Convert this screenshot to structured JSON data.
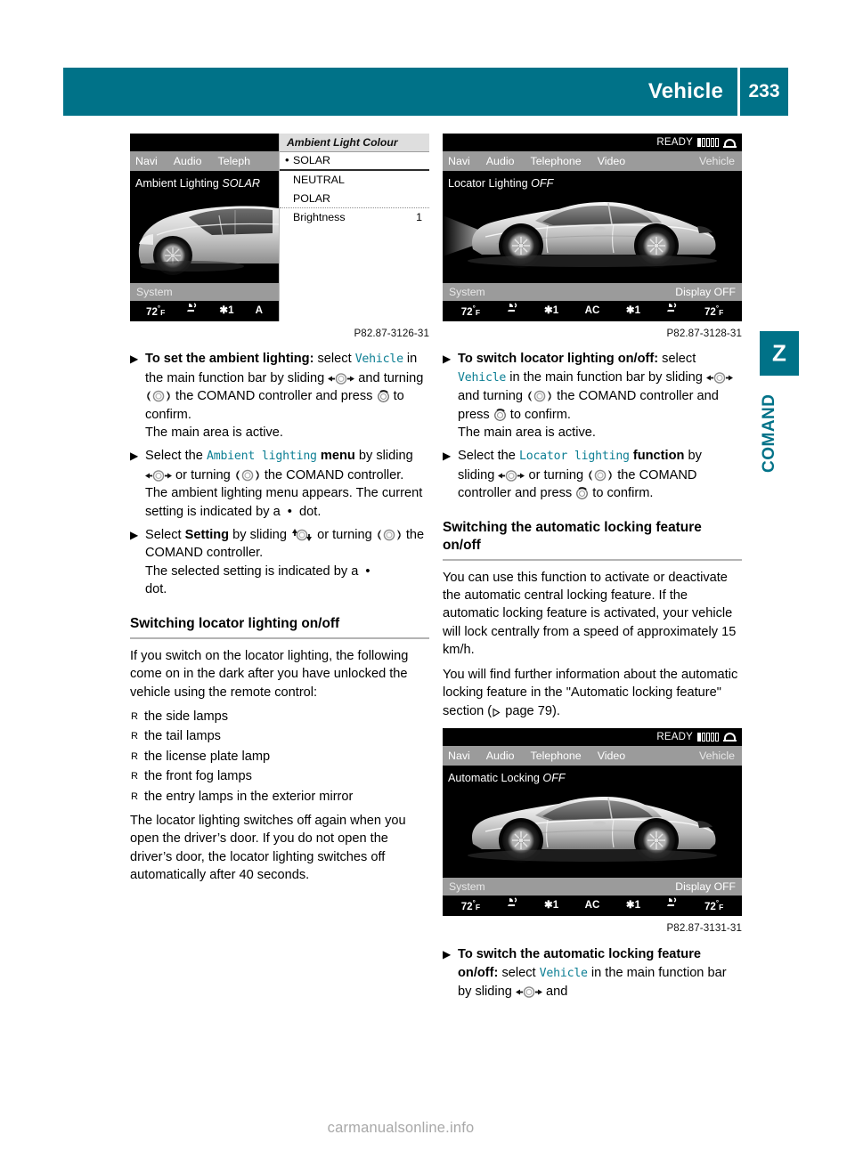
{
  "header": {
    "title": "Vehicle",
    "page_number": "233"
  },
  "side_tab": {
    "marker_letter": "Z",
    "label": "COMAND"
  },
  "figures": {
    "ambient": {
      "caption": "P82.87-3126-31",
      "menubar": [
        "Navi",
        "Audio",
        "Teleph"
      ],
      "main_title": "Ambient Lighting",
      "main_title_value": "SOLAR",
      "sysbar_left": "System",
      "climate": [
        "72",
        "F",
        "°1",
        "A"
      ],
      "climate_left_temp": "72",
      "climate_unit": "F",
      "climate_fan": "1",
      "list_title": "Ambient Light Colour",
      "list_items": [
        {
          "bullet": "•",
          "label": "SOLAR",
          "value": ""
        },
        {
          "bullet": "",
          "label": "NEUTRAL",
          "value": ""
        },
        {
          "bullet": "",
          "label": "POLAR",
          "value": ""
        },
        {
          "bullet": "",
          "label": "Brightness",
          "value": "1"
        }
      ]
    },
    "locator": {
      "caption": "P82.87-3128-31",
      "status_text": "READY",
      "menubar": [
        "Navi",
        "Audio",
        "Telephone",
        "Video"
      ],
      "menubar_selected": "Vehicle",
      "main_title": "Locator Lighting",
      "main_title_value": "OFF",
      "sysbar_left": "System",
      "sysbar_right": "Display OFF",
      "climate_left_temp": "72",
      "climate_right_temp": "72",
      "climate_unit": "F",
      "climate_fan_left": "1",
      "climate_fan_right": "1",
      "climate_ac": "AC"
    },
    "autolock": {
      "caption": "P82.87-3131-31",
      "status_text": "READY",
      "menubar": [
        "Navi",
        "Audio",
        "Telephone",
        "Video"
      ],
      "menubar_selected": "Vehicle",
      "main_title": "Automatic Locking",
      "main_title_value": "OFF",
      "sysbar_left": "System",
      "sysbar_right": "Display OFF",
      "climate_left_temp": "72",
      "climate_right_temp": "72",
      "climate_unit": "F",
      "climate_fan_left": "1",
      "climate_fan_right": "1",
      "climate_ac": "AC"
    }
  },
  "left_column": {
    "step1": {
      "lead": "To set the ambient lighting:",
      "t1": " select ",
      "mono1": "Vehicle",
      "t2": " in the main function bar by sliding ",
      "t3": " and turning ",
      "t4": " the COMAND controller and press ",
      "t5": " to confirm.",
      "result": "The main area is active."
    },
    "step2": {
      "t1": "Select the ",
      "mono1": "Ambient lighting",
      "bold1": " menu",
      "t2": " by sliding ",
      "t3": " or turning ",
      "t4": " the COMAND controller.",
      "result": "The ambient lighting menu appears. The current setting is indicated by a",
      "result_tail": "dot."
    },
    "step3": {
      "t1": "Select ",
      "bold1": "Setting",
      "t2": " by sliding ",
      "t3": " or turning ",
      "t4": " the COMAND controller.",
      "result": "The selected setting is indicated by a",
      "result_tail": "dot."
    },
    "heading": "Switching locator lighting on/off",
    "intro": "If you switch on the locator lighting, the following come on in the dark after you have unlocked the vehicle using the remote control:",
    "lamp_list": [
      "the side lamps",
      "the tail lamps",
      "the license plate lamp",
      "the front fog lamps",
      "the entry lamps in the exterior mirror"
    ],
    "outro": "The locator lighting switches off again when you open the driver’s door. If you do not open the driver’s door, the locator lighting switches off automatically after 40 seconds."
  },
  "right_column": {
    "step1": {
      "lead": "To switch locator lighting on/off:",
      "t1": " select ",
      "mono1": "Vehicle",
      "t2": " in the main function bar by sliding ",
      "t3": " and turning ",
      "t4": " the COMAND controller and press ",
      "t5": " to confirm.",
      "result": "The main area is active."
    },
    "step2": {
      "t1": "Select the ",
      "mono1": "Locator lighting",
      "bold1": " function",
      "t2": " by sliding ",
      "t3": " or turning ",
      "t4": " the COMAND controller and press ",
      "t5": " to confirm."
    },
    "heading": "Switching the automatic locking feature on/off",
    "para1": "You can use this function to activate or deactivate the automatic central locking feature. If the automatic locking feature is activated, your vehicle will lock centrally from a speed of approximately 15 km/h.",
    "para2_a": "You will find further information about the automatic locking feature in the \"Automatic locking feature\" section (",
    "para2_ref": " page 79",
    "para2_b": ").",
    "step3": {
      "lead": "To switch the automatic locking feature on/off:",
      "t1": " select ",
      "mono1": "Vehicle",
      "t2": " in the main function bar by sliding ",
      "t3": " and"
    }
  },
  "watermark": "carmanualsonline.info",
  "colors": {
    "accent_teal": "#007288",
    "mono_teal": "#0d7f94"
  }
}
